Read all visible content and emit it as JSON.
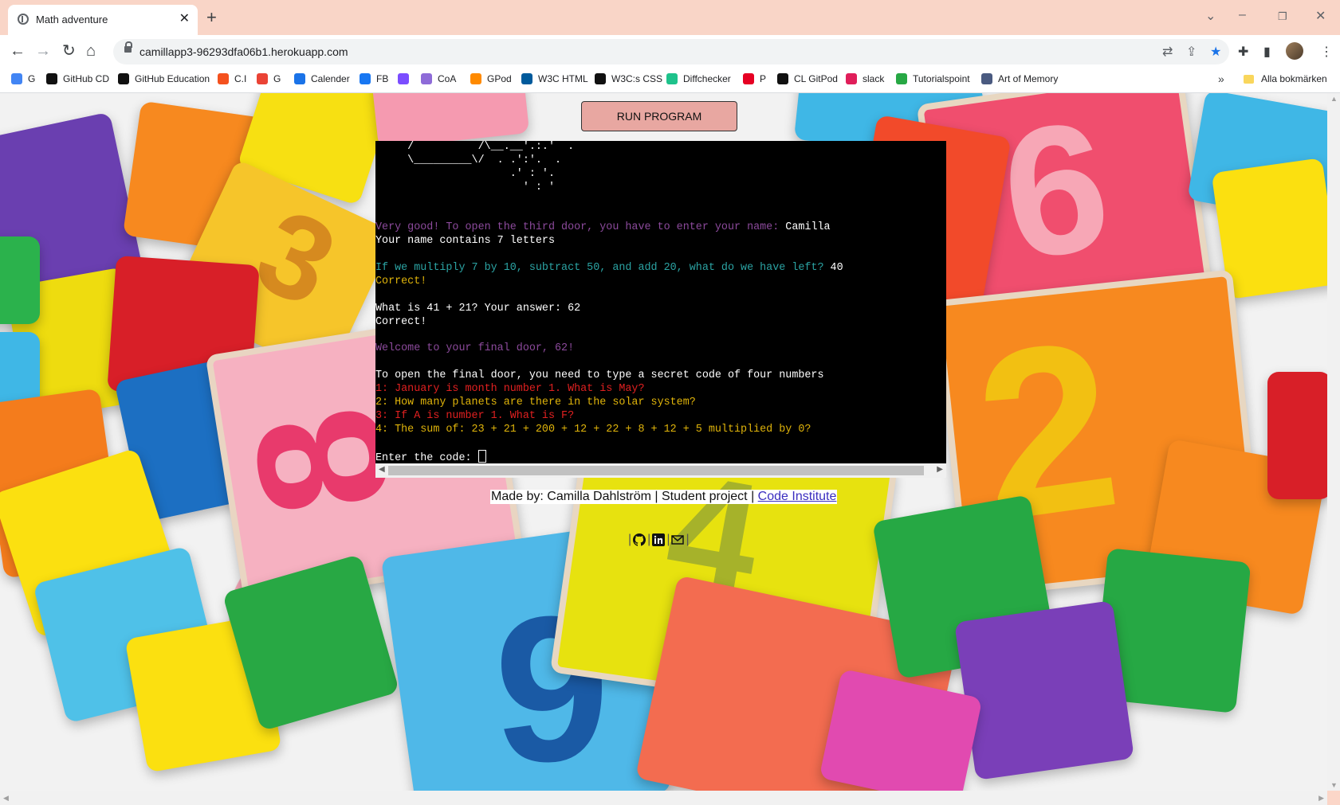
{
  "browser": {
    "tab_title": "Math adventure",
    "url": "camillapp3-96293dfa06b1.herokuapp.com",
    "window_controls": [
      "chevron-down-icon",
      "minimize-icon",
      "restore-icon",
      "close-icon"
    ],
    "bookmarks": [
      {
        "label": "G",
        "icon": "google-icon",
        "color": "#4285f4"
      },
      {
        "label": "GitHub CD",
        "icon": "github-icon",
        "color": "#111111"
      },
      {
        "label": "GitHub Education",
        "icon": "github-icon",
        "color": "#111111"
      },
      {
        "label": "C.I",
        "icon": "ci-icon",
        "color": "#f4511e"
      },
      {
        "label": "G",
        "icon": "gmail-icon",
        "color": "#ea4335"
      },
      {
        "label": "Calender",
        "icon": "calendar-icon",
        "color": "#1a73e8"
      },
      {
        "label": "FB",
        "icon": "facebook-icon",
        "color": "#1877f2"
      },
      {
        "label": "",
        "icon": "circle-c-icon",
        "color": "#7b4dff"
      },
      {
        "label": "CoA",
        "icon": "cube-icon",
        "color": "#8e6bd8"
      },
      {
        "label": "GPod",
        "icon": "gitpod-icon",
        "color": "#ff8a00"
      },
      {
        "label": "W3C HTML",
        "icon": "w3c-icon",
        "color": "#005a9c"
      },
      {
        "label": "W3C:s CSS",
        "icon": "w3c-css-icon",
        "color": "#111111"
      },
      {
        "label": "Diffchecker",
        "icon": "diffchecker-icon",
        "color": "#1ec28b"
      },
      {
        "label": "P",
        "icon": "pinterest-icon",
        "color": "#e60023"
      },
      {
        "label": "CL GitPod",
        "icon": "github-icon",
        "color": "#111111"
      },
      {
        "label": "slack",
        "icon": "slack-icon",
        "color": "#e01e5a"
      },
      {
        "label": "Tutorialspoint",
        "icon": "tutorialspoint-icon",
        "color": "#27a844"
      },
      {
        "label": "Art of Memory",
        "icon": "artofmemory-icon",
        "color": "#4a5a80"
      }
    ],
    "more_bookmarks": "»",
    "all_bookmarks": "Alla bokmärken"
  },
  "app": {
    "run_button": "RUN PROGRAM",
    "terminal_lines": [
      {
        "segments": [
          {
            "t": "     /          /\\__.__'.:.'  .",
            "c": "white"
          }
        ]
      },
      {
        "segments": [
          {
            "t": "     \\_________\\/  . .':'.  .",
            "c": "white"
          }
        ]
      },
      {
        "segments": [
          {
            "t": "                     .' : '.",
            "c": "white"
          }
        ]
      },
      {
        "segments": [
          {
            "t": "                       ' : '",
            "c": "white"
          }
        ]
      },
      {
        "segments": [
          {
            "t": "",
            "c": "white"
          }
        ]
      },
      {
        "segments": [
          {
            "t": "",
            "c": "white"
          }
        ]
      },
      {
        "segments": [
          {
            "t": "Very good! To open the third door, you have to enter your name: ",
            "c": "purple"
          },
          {
            "t": "Camilla",
            "c": "white"
          }
        ]
      },
      {
        "segments": [
          {
            "t": "Your name contains 7 letters",
            "c": "white"
          }
        ]
      },
      {
        "segments": [
          {
            "t": "",
            "c": "white"
          }
        ]
      },
      {
        "segments": [
          {
            "t": "If we multiply 7 by 10, subtract 50, and add 20, what do we have left? ",
            "c": "teal"
          },
          {
            "t": "40",
            "c": "white"
          }
        ]
      },
      {
        "segments": [
          {
            "t": "Correct!",
            "c": "yellow"
          }
        ]
      },
      {
        "segments": [
          {
            "t": "",
            "c": "white"
          }
        ]
      },
      {
        "segments": [
          {
            "t": "What is 41 + 21? Your answer: 62",
            "c": "white"
          }
        ]
      },
      {
        "segments": [
          {
            "t": "Correct!",
            "c": "white"
          }
        ]
      },
      {
        "segments": [
          {
            "t": "",
            "c": "white"
          }
        ]
      },
      {
        "segments": [
          {
            "t": "Welcome to your final door, 62!",
            "c": "purple"
          }
        ]
      },
      {
        "segments": [
          {
            "t": "",
            "c": "white"
          }
        ]
      },
      {
        "segments": [
          {
            "t": "To open the final door, you need to type a secret code of four numbers",
            "c": "white"
          }
        ]
      },
      {
        "segments": [
          {
            "t": "1: January is month number 1. What is May?",
            "c": "red"
          }
        ]
      },
      {
        "segments": [
          {
            "t": "2: How many planets are there in the solar system?",
            "c": "yellow"
          }
        ]
      },
      {
        "segments": [
          {
            "t": "3: If A is number 1. What is F?",
            "c": "red"
          }
        ]
      },
      {
        "segments": [
          {
            "t": "4: The sum of: 23 + 21 + 200 + 12 + 22 + 8 + 12 + 5 multiplied by 0?",
            "c": "yellow"
          }
        ]
      },
      {
        "segments": [
          {
            "t": "",
            "c": "white"
          }
        ]
      },
      {
        "segments": [
          {
            "t": "Enter the code: ",
            "c": "white"
          }
        ],
        "cursor": true
      }
    ],
    "footer": {
      "text": "Made by: Camilla Dahlström | Student project | ",
      "link": "Code Institute"
    },
    "social": [
      {
        "icon": "github-icon"
      },
      {
        "icon": "linkedin-icon"
      },
      {
        "icon": "envelope-icon"
      }
    ],
    "social_separator": "|"
  }
}
